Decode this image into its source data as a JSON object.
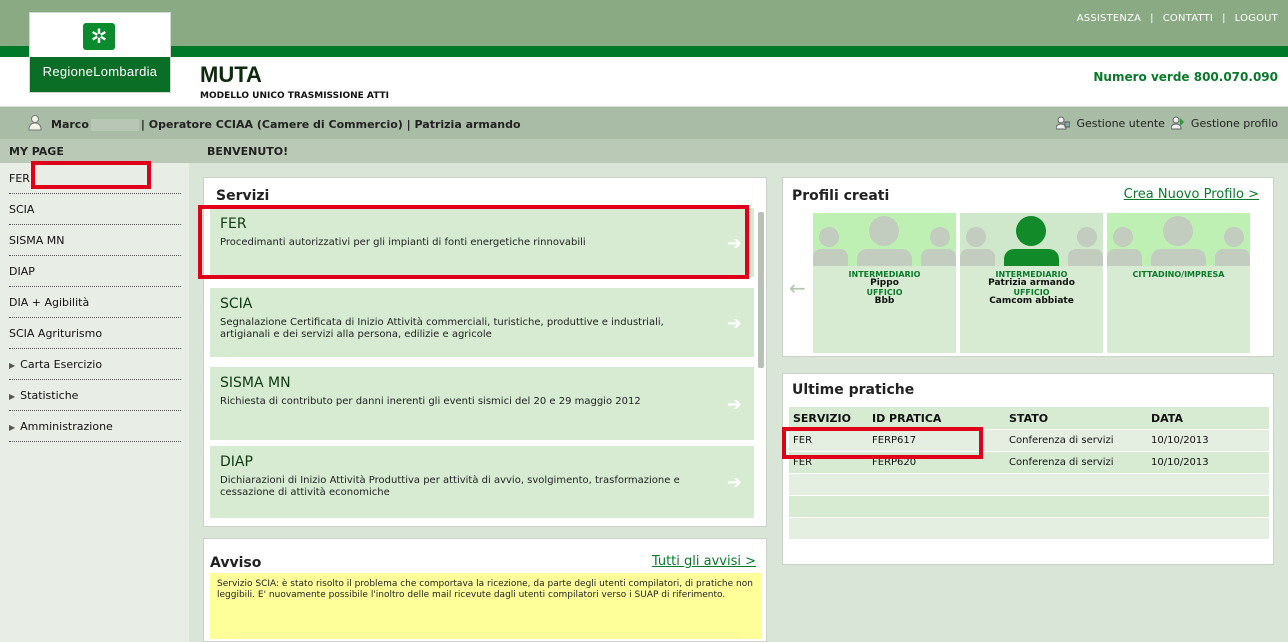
{
  "top_links": [
    "ASSISTENZA",
    "CONTATTI",
    "LOGOUT"
  ],
  "logo": {
    "text": "RegioneLombardia",
    "mark": "✲"
  },
  "app": {
    "title": "MUTA",
    "subtitle": "MODELLO UNICO TRASMISSIONE ATTI",
    "numero_verde": "Numero verde 800.070.090"
  },
  "userbar": {
    "user_first": "Marco",
    "user_role": "| Operatore CCIAA (Camere di Commercio) | Patrizia armando",
    "gestione_utente": "Gestione utente",
    "gestione_profilo": "Gestione profilo"
  },
  "sidebar": {
    "title": "MY PAGE",
    "items": [
      {
        "label": "FER",
        "expandable": false
      },
      {
        "label": "SCIA",
        "expandable": false
      },
      {
        "label": "SISMA MN",
        "expandable": false
      },
      {
        "label": "DIAP",
        "expandable": false
      },
      {
        "label": "DIA + Agibilità",
        "expandable": false
      },
      {
        "label": "SCIA Agriturismo",
        "expandable": false
      },
      {
        "label": "Carta Esercizio",
        "expandable": true
      },
      {
        "label": "Statistiche",
        "expandable": true
      },
      {
        "label": "Amministrazione",
        "expandable": true
      }
    ]
  },
  "main": {
    "title": "BENVENUTO!"
  },
  "services": {
    "title": "Servizi",
    "items": [
      {
        "name": "FER",
        "desc": "Procedimanti autorizzativi per gli impianti di fonti energetiche rinnovabili"
      },
      {
        "name": "SCIA",
        "desc": "Segnalazione Certificata di Inizio Attività commerciali, turistiche, produttive e industriali, artigianali e dei servizi alla persona, edilizie e agricole"
      },
      {
        "name": "SISMA MN",
        "desc": "Richiesta di contributo per danni inerenti gli eventi sismici del 20 e 29 maggio 2012"
      },
      {
        "name": "DIAP",
        "desc": "Dichiarazioni di Inizio Attività Produttiva per attività di avvio, svolgimento, trasformazione e cessazione di attività economiche"
      }
    ]
  },
  "avviso": {
    "title": "Avviso",
    "link": "Tutti gli avvisi >",
    "body": "Servizio SCIA: è stato risolto il problema che comportava la ricezione, da parte degli utenti compilatori, di pratiche non leggibili. E' nuovamente possibile l'inoltro delle mail ricevute dagli utenti compilatori verso i SUAP di riferimento."
  },
  "profili": {
    "title": "Profili creati",
    "link": "Crea Nuovo Profilo >",
    "cards": [
      {
        "role": "INTERMEDIARIO",
        "name": "Pippo",
        "uff_label": "UFFICIO",
        "uff": "Bbb",
        "active": false
      },
      {
        "role": "INTERMEDIARIO",
        "name": "Patrizia armando",
        "uff_label": "UFFICIO",
        "uff": "Camcom abbiate",
        "active": true
      },
      {
        "role": "CITTADINO/IMPRESA",
        "name": "",
        "uff_label": "",
        "uff": "",
        "active": false
      }
    ]
  },
  "ultime": {
    "title": "Ultime pratiche",
    "headers": [
      "SERVIZIO",
      "ID PRATICA",
      "STATO",
      "DATA"
    ],
    "rows": [
      [
        "FER",
        "FERP617",
        "Conferenza di servizi",
        "10/10/2013"
      ],
      [
        "FER",
        "FERP620",
        "Conferenza di servizi",
        "10/10/2013"
      ]
    ]
  },
  "colors": {
    "brand_green": "#0a7a2a",
    "highlight_red": "#e0001a",
    "notice_yellow": "#ffff99"
  }
}
